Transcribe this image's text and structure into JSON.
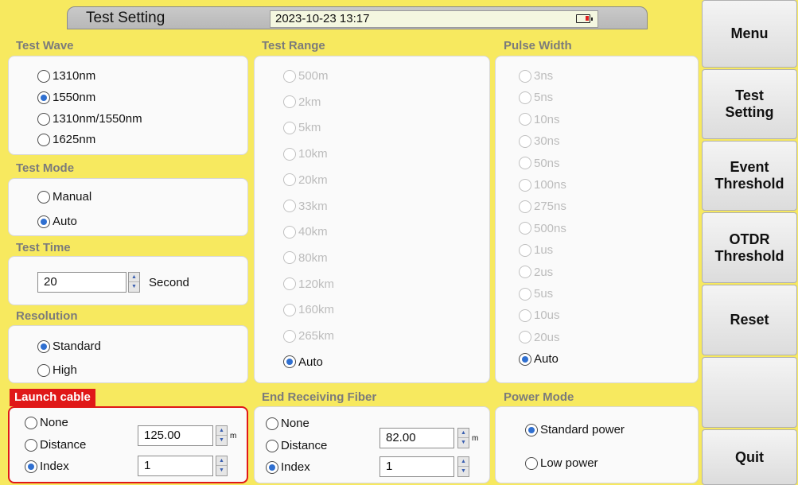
{
  "header": {
    "title": "Test Setting",
    "datetime": "2023-10-23 13:17",
    "battery_icon": "battery-low-icon"
  },
  "test_wave": {
    "heading": "Test Wave",
    "options": [
      "1310nm",
      "1550nm",
      "1310nm/1550nm",
      "1625nm"
    ],
    "selected": "1550nm"
  },
  "test_mode": {
    "heading": "Test Mode",
    "options": [
      "Manual",
      "Auto"
    ],
    "selected": "Auto"
  },
  "test_time": {
    "heading": "Test Time",
    "value": "20",
    "unit": "Second"
  },
  "resolution": {
    "heading": "Resolution",
    "options": [
      "Standard",
      "High"
    ],
    "selected": "Standard"
  },
  "test_range": {
    "heading": "Test Range",
    "options": [
      "500m",
      "2km",
      "5km",
      "10km",
      "20km",
      "33km",
      "40km",
      "80km",
      "120km",
      "160km",
      "265km",
      "Auto"
    ],
    "selected": "Auto"
  },
  "pulse_width": {
    "heading": "Pulse Width",
    "options": [
      "3ns",
      "5ns",
      "10ns",
      "30ns",
      "50ns",
      "100ns",
      "275ns",
      "500ns",
      "1us",
      "2us",
      "5us",
      "10us",
      "20us",
      "Auto"
    ],
    "selected": "Auto"
  },
  "launch_cable": {
    "heading": "Launch cable",
    "options": [
      "None",
      "Distance",
      "Index"
    ],
    "selected": "Index",
    "distance_value": "125.00",
    "distance_unit": "m",
    "index_value": "1"
  },
  "end_receiving_fiber": {
    "heading": "End Receiving Fiber",
    "options": [
      "None",
      "Distance",
      "Index"
    ],
    "selected": "Index",
    "distance_value": "82.00",
    "distance_unit": "m",
    "index_value": "1"
  },
  "power_mode": {
    "heading": "Power Mode",
    "options": [
      "Standard power",
      "Low power"
    ],
    "selected": "Standard power"
  },
  "menu": {
    "items": [
      "Menu",
      "Test\nSetting",
      "Event\nThreshold",
      "OTDR\nThreshold",
      "Reset",
      "",
      "Quit"
    ]
  },
  "colors": {
    "background": "#f7e95f",
    "accent_red": "#e01818",
    "radio_selected": "#2f6fd0"
  }
}
